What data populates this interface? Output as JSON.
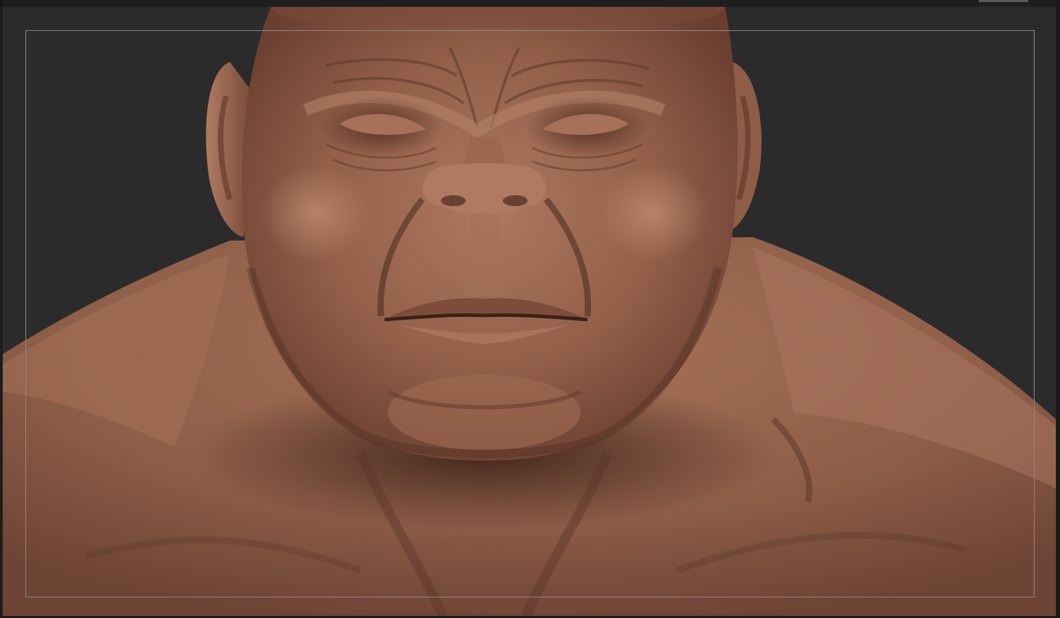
{
  "viewport": {
    "background_color": "#2b2b2b",
    "frame_color": "#8c8c8c",
    "material_color": "#9c6a52",
    "material_shadow_color": "#3e241a",
    "material_highlight_color": "#c18c70"
  },
  "subject": {
    "icon": "sculpted-bust-icon"
  }
}
